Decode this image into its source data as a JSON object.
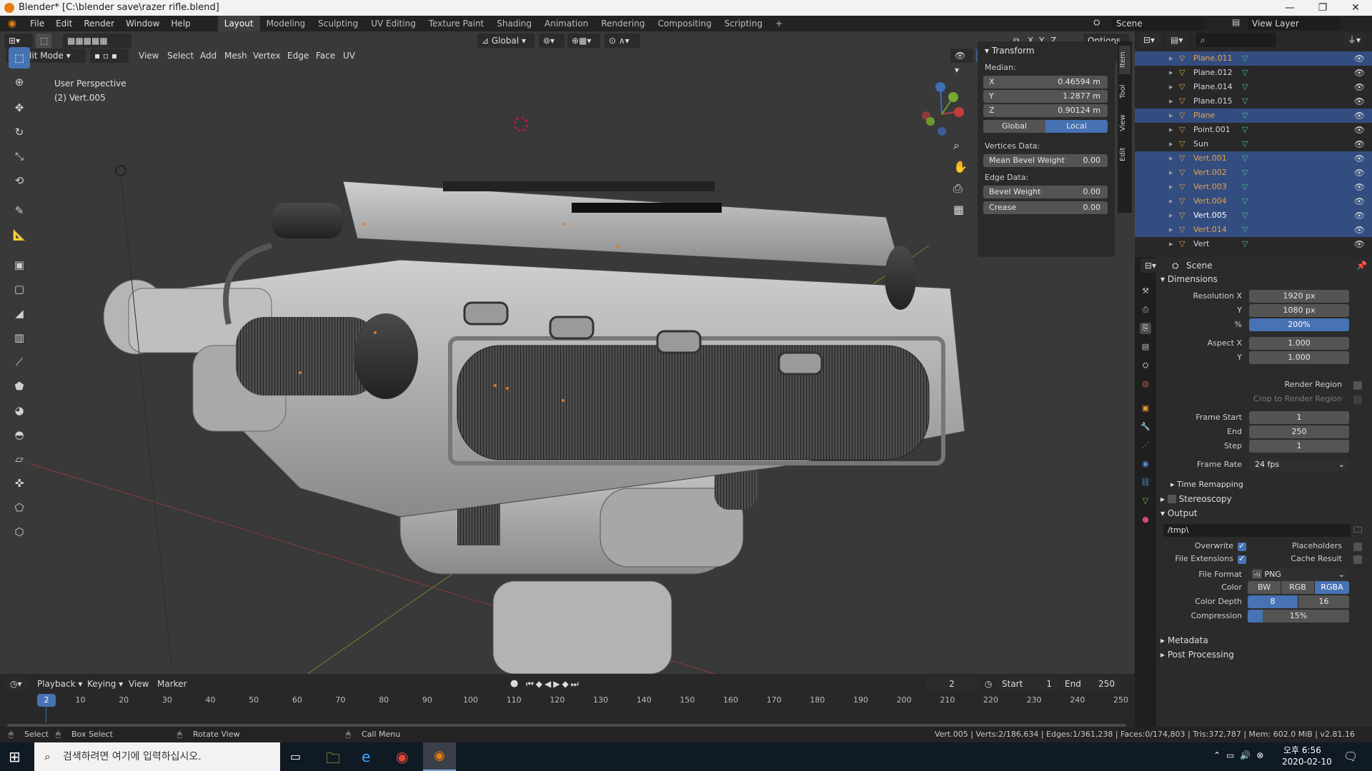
{
  "window": {
    "title": "Blender* [C:\\blender save\\razer rifle.blend]",
    "minimize": "—",
    "restore": "❐",
    "close": "✕"
  },
  "menu": [
    "File",
    "Edit",
    "Render",
    "Window",
    "Help"
  ],
  "workspaces": [
    "Layout",
    "Modeling",
    "Sculpting",
    "UV Editing",
    "Texture Paint",
    "Shading",
    "Animation",
    "Rendering",
    "Compositing",
    "Scripting"
  ],
  "active_workspace": "Layout",
  "scene": {
    "label": "Scene",
    "view_layer": "View Layer"
  },
  "viewport": {
    "mode": "Edit Mode",
    "menus": [
      "View",
      "Select",
      "Add",
      "Mesh",
      "Vertex",
      "Edge",
      "Face",
      "UV"
    ],
    "orientation": "Global",
    "axes": [
      "X",
      "Y",
      "Z"
    ],
    "options": "Options",
    "perspective": "User Perspective",
    "object": "(2) Vert.005"
  },
  "npanel": {
    "title": "Transform",
    "median": "Median:",
    "x": {
      "label": "X",
      "value": "0.46594 m"
    },
    "y": {
      "label": "Y",
      "value": "1.2877 m"
    },
    "z": {
      "label": "Z",
      "value": "0.90124 m"
    },
    "global": "Global",
    "local": "Local",
    "vertices_data": "Vertices Data:",
    "mean_bevel": {
      "label": "Mean Bevel Weight",
      "value": "0.00"
    },
    "edge_data": "Edge Data:",
    "bevel": {
      "label": "Bevel Weight",
      "value": "0.00"
    },
    "crease": {
      "label": "Crease",
      "value": "0.00"
    },
    "tabs": [
      "Item",
      "Tool",
      "View",
      "Edit"
    ]
  },
  "outliner": {
    "rows": [
      {
        "name": "Plane.011",
        "selected": true,
        "color": "#e8a24a"
      },
      {
        "name": "Plane.012",
        "selected": false,
        "color": "#d6d6d6"
      },
      {
        "name": "Plane.014",
        "selected": false,
        "color": "#d6d6d6"
      },
      {
        "name": "Plane.015",
        "selected": false,
        "color": "#d6d6d6"
      },
      {
        "name": "Plane",
        "selected": true,
        "color": "#e8a24a"
      },
      {
        "name": "Point.001",
        "selected": false,
        "color": "#d6d6d6"
      },
      {
        "name": "Sun",
        "selected": false,
        "color": "#d6d6d6"
      },
      {
        "name": "Vert.001",
        "selected": true,
        "color": "#e8a24a"
      },
      {
        "name": "Vert.002",
        "selected": true,
        "color": "#e8a24a"
      },
      {
        "name": "Vert.003",
        "selected": true,
        "color": "#e8a24a"
      },
      {
        "name": "Vert.004",
        "selected": true,
        "color": "#e8a24a"
      },
      {
        "name": "Vert.005",
        "selected": true,
        "color": "#ffffff"
      },
      {
        "name": "Vert.014",
        "selected": true,
        "color": "#e8a24a"
      },
      {
        "name": "Vert",
        "selected": false,
        "color": "#d6d6d6"
      }
    ]
  },
  "properties": {
    "context": "Scene",
    "dimensions": "Dimensions",
    "res_x": {
      "label": "Resolution X",
      "value": "1920 px"
    },
    "res_y": {
      "label": "Y",
      "value": "1080 px"
    },
    "res_pct": {
      "label": "%",
      "value": "200%"
    },
    "aspect_x": {
      "label": "Aspect X",
      "value": "1.000"
    },
    "aspect_y": {
      "label": "Y",
      "value": "1.000"
    },
    "render_region": "Render Region",
    "crop": "Crop to Render Region",
    "frame_start": {
      "label": "Frame Start",
      "value": "1"
    },
    "frame_end": {
      "label": "End",
      "value": "250"
    },
    "frame_step": {
      "label": "Step",
      "value": "1"
    },
    "frame_rate": {
      "label": "Frame Rate",
      "value": "24 fps"
    },
    "time_remap": "Time Remapping",
    "stereo": "Stereoscopy",
    "output": "Output",
    "path": "/tmp\\",
    "overwrite": "Overwrite",
    "placeholders": "Placeholders",
    "file_ext": "File Extensions",
    "cache": "Cache Result",
    "file_format": {
      "label": "File Format",
      "value": "PNG"
    },
    "color": {
      "label": "Color",
      "options": [
        "BW",
        "RGB",
        "RGBA"
      ],
      "selected": "RGBA"
    },
    "color_depth": {
      "label": "Color Depth",
      "options": [
        "8",
        "16"
      ],
      "selected": "8"
    },
    "compression": {
      "label": "Compression",
      "value": "15%",
      "fraction": 0.15
    },
    "metadata": "Metadata",
    "post": "Post Processing"
  },
  "timeline": {
    "menus": [
      "Playback",
      "Keying",
      "View",
      "Marker"
    ],
    "current": "2",
    "start_label": "Start",
    "start": "1",
    "end_label": "End",
    "end": "250",
    "ticks": [
      "10",
      "20",
      "30",
      "40",
      "50",
      "60",
      "70",
      "80",
      "90",
      "100",
      "110",
      "120",
      "130",
      "140",
      "150",
      "160",
      "170",
      "180",
      "190",
      "200",
      "210",
      "220",
      "230",
      "240",
      "250"
    ],
    "marker": "2"
  },
  "status": {
    "select": "Select",
    "box": "Box Select",
    "rotate": "Rotate View",
    "call": "Call Menu",
    "stats": "Vert.005 | Verts:2/186,634 | Edges:1/361,238 | Faces:0/174,803 | Tris:372,787 | Mem: 602.0 MiB | v2.81.16"
  },
  "taskbar": {
    "search": "검색하려면 여기에 입력하십시오.",
    "time": "오후 6:56",
    "date": "2020-02-10"
  }
}
